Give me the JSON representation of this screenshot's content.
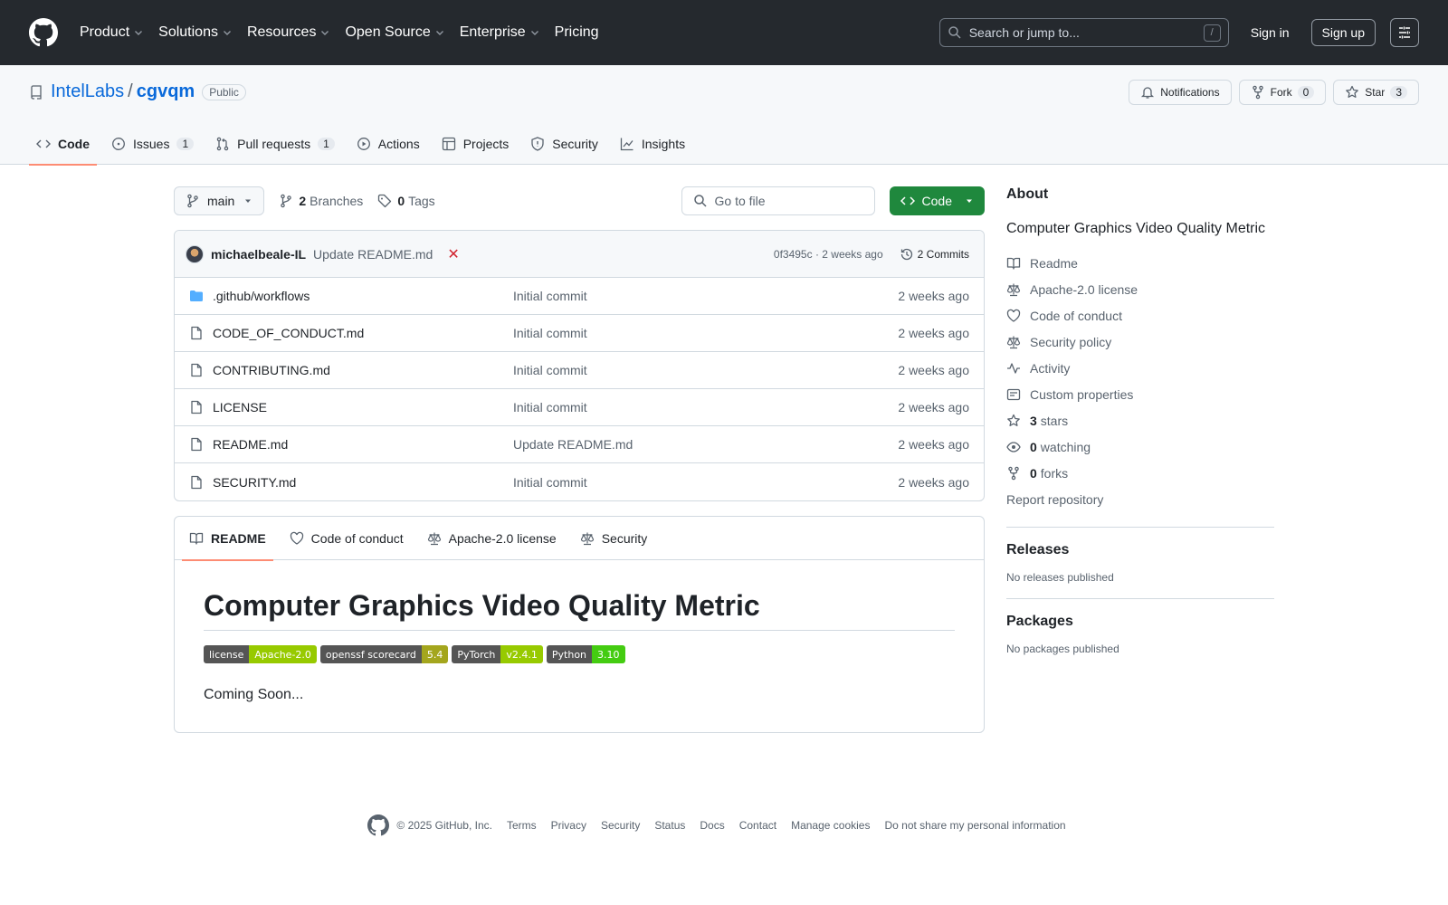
{
  "header": {
    "nav": [
      "Product",
      "Solutions",
      "Resources",
      "Open Source",
      "Enterprise",
      "Pricing"
    ],
    "search_placeholder": "Search or jump to...",
    "search_key": "/",
    "sign_in": "Sign in",
    "sign_up": "Sign up"
  },
  "repo": {
    "owner": "IntelLabs",
    "name": "cgvqm",
    "visibility": "Public",
    "notifications": "Notifications",
    "fork_label": "Fork",
    "fork_count": "0",
    "star_label": "Star",
    "star_count": "3",
    "tabs": [
      {
        "label": "Code",
        "count": ""
      },
      {
        "label": "Issues",
        "count": "1"
      },
      {
        "label": "Pull requests",
        "count": "1"
      },
      {
        "label": "Actions",
        "count": ""
      },
      {
        "label": "Projects",
        "count": ""
      },
      {
        "label": "Security",
        "count": ""
      },
      {
        "label": "Insights",
        "count": ""
      }
    ]
  },
  "toolbar": {
    "branch": "main",
    "branches_count": "2",
    "branches_label": "Branches",
    "tags_count": "0",
    "tags_label": "Tags",
    "goto_placeholder": "Go to file",
    "code_button": "Code"
  },
  "commit": {
    "author": "michaelbeale-IL",
    "message": "Update README.md",
    "status": "✕",
    "meta": "0f3495c · 2 weeks ago",
    "commits": "2 Commits"
  },
  "files": [
    {
      "name": ".github/workflows",
      "type": "folder",
      "message": "Initial commit",
      "time": "2 weeks ago"
    },
    {
      "name": "CODE_OF_CONDUCT.md",
      "type": "file",
      "message": "Initial commit",
      "time": "2 weeks ago"
    },
    {
      "name": "CONTRIBUTING.md",
      "type": "file",
      "message": "Initial commit",
      "time": "2 weeks ago"
    },
    {
      "name": "LICENSE",
      "type": "file",
      "message": "Initial commit",
      "time": "2 weeks ago"
    },
    {
      "name": "README.md",
      "type": "file",
      "message": "Update README.md",
      "time": "2 weeks ago"
    },
    {
      "name": "SECURITY.md",
      "type": "file",
      "message": "Initial commit",
      "time": "2 weeks ago"
    }
  ],
  "readme": {
    "tabs": [
      "README",
      "Code of conduct",
      "Apache-2.0 license",
      "Security"
    ],
    "title": "Computer Graphics Video Quality Metric",
    "badges": [
      {
        "label": "license",
        "value": "Apache-2.0",
        "color": "#97ca00"
      },
      {
        "label": "openssf scorecard",
        "value": "5.4",
        "color": "#a4a61d"
      },
      {
        "label": "PyTorch",
        "value": "v2.4.1",
        "color": "#97ca00"
      },
      {
        "label": "Python",
        "value": "3.10",
        "color": "#4c1"
      }
    ],
    "text": "Coming Soon..."
  },
  "about": {
    "heading": "About",
    "description": "Computer Graphics Video Quality Metric",
    "links": [
      {
        "icon": "book-icon",
        "bold": "",
        "label": "Readme"
      },
      {
        "icon": "law-icon",
        "bold": "",
        "label": "Apache-2.0 license"
      },
      {
        "icon": "heart-icon",
        "bold": "",
        "label": "Code of conduct"
      },
      {
        "icon": "law-icon",
        "bold": "",
        "label": "Security policy"
      },
      {
        "icon": "pulse-icon",
        "bold": "",
        "label": "Activity"
      },
      {
        "icon": "note-icon",
        "bold": "",
        "label": "Custom properties"
      },
      {
        "icon": "star-icon",
        "bold": "3",
        "label": "stars"
      },
      {
        "icon": "eye-icon",
        "bold": "0",
        "label": "watching"
      },
      {
        "icon": "fork-icon",
        "bold": "0",
        "label": "forks"
      },
      {
        "icon": "",
        "bold": "",
        "label": "Report repository"
      }
    ]
  },
  "releases": {
    "heading": "Releases",
    "note": "No releases published"
  },
  "packages": {
    "heading": "Packages",
    "note": "No packages published"
  },
  "footer": {
    "copyright": "© 2025 GitHub, Inc.",
    "links": [
      "Terms",
      "Privacy",
      "Security",
      "Status",
      "Docs",
      "Contact",
      "Manage cookies",
      "Do not share my personal information"
    ]
  }
}
